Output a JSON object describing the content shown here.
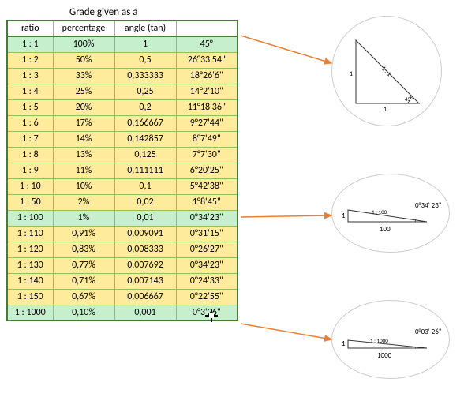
{
  "title": "Grade given as a",
  "headers": {
    "ratio": "ratio",
    "percentage": "percentage",
    "angle_tan": "angle (tan)",
    "angle": ""
  },
  "rows": [
    {
      "cls": "green",
      "ratio": "1 : 1",
      "pct": "100%",
      "tan": "1",
      "ang": "45°"
    },
    {
      "cls": "yellow",
      "ratio": "1 : 2",
      "pct": "50%",
      "tan": "0,5",
      "ang": "26°33'54\""
    },
    {
      "cls": "yellow",
      "ratio": "1 : 3",
      "pct": "33%",
      "tan": "0,333333",
      "ang": "18°26'6\""
    },
    {
      "cls": "yellow",
      "ratio": "1 : 4",
      "pct": "25%",
      "tan": "0,25",
      "ang": "14°2'10\""
    },
    {
      "cls": "yellow",
      "ratio": "1 : 5",
      "pct": "20%",
      "tan": "0,2",
      "ang": "11°18'36\""
    },
    {
      "cls": "yellow",
      "ratio": "1 : 6",
      "pct": "17%",
      "tan": "0,166667",
      "ang": "9°27'44\""
    },
    {
      "cls": "yellow",
      "ratio": "1 : 7",
      "pct": "14%",
      "tan": "0,142857",
      "ang": "8°7'49\""
    },
    {
      "cls": "yellow",
      "ratio": "1 : 8",
      "pct": "13%",
      "tan": "0,125",
      "ang": "7°7'30\""
    },
    {
      "cls": "yellow",
      "ratio": "1 : 9",
      "pct": "11%",
      "tan": "0,111111",
      "ang": "6°20'25\""
    },
    {
      "cls": "yellow",
      "ratio": "1 : 10",
      "pct": "10%",
      "tan": "0,1",
      "ang": "5°42'38\""
    },
    {
      "cls": "yellow",
      "ratio": "1 : 50",
      "pct": "2%",
      "tan": "0,02",
      "ang": "1°8'45\""
    },
    {
      "cls": "green",
      "ratio": "1 : 100",
      "pct": "1%",
      "tan": "0,01",
      "ang": "0°34'23\""
    },
    {
      "cls": "yellow",
      "ratio": "1 : 110",
      "pct": "0,91%",
      "tan": "0,009091",
      "ang": "0°31'15\""
    },
    {
      "cls": "yellow",
      "ratio": "1 : 120",
      "pct": "0,83%",
      "tan": "0,008333",
      "ang": "0°26'27\""
    },
    {
      "cls": "yellow",
      "ratio": "1 : 130",
      "pct": "0,77%",
      "tan": "0,007692",
      "ang": "0°34'23\""
    },
    {
      "cls": "yellow",
      "ratio": "1 : 140",
      "pct": "0,71%",
      "tan": "0,007143",
      "ang": "0°24'33\""
    },
    {
      "cls": "yellow",
      "ratio": "1 : 150",
      "pct": "0,67%",
      "tan": "0,006667",
      "ang": "0°22'55\""
    },
    {
      "cls": "green",
      "ratio": "1 : 1000",
      "pct": "0,10%",
      "tan": "0,001",
      "ang": "0°3'26\""
    }
  ],
  "diagrams": {
    "d1": {
      "side_v": "1",
      "side_h": "1",
      "hyp": "1 : 1",
      "angle": "45°"
    },
    "d2": {
      "side_v": "1",
      "side_h": "100",
      "hyp": "1 : 100",
      "angle": "0°34' 23\""
    },
    "d3": {
      "side_v": "1",
      "side_h": "1000",
      "hyp": "1 : 1000",
      "angle": "0°03' 26\""
    }
  }
}
